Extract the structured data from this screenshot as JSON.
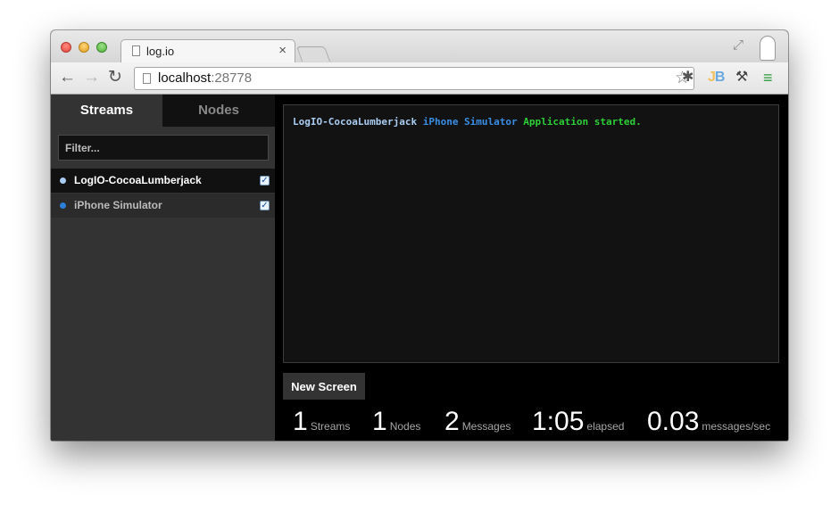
{
  "browser": {
    "tab_title": "log.io",
    "tab_close": "×",
    "url_host": "localhost",
    "url_port": ":28778",
    "nav": {
      "back": "←",
      "forward": "→",
      "reload": "C"
    },
    "icons": [
      "page-icon",
      "star-icon",
      "bug-extension-icon",
      "jb-extension-icon",
      "wrench-icon",
      "menu-icon",
      "fullscreen-icon",
      "profile-icon"
    ]
  },
  "sidebar": {
    "tabs": [
      {
        "label": "Streams",
        "active": true
      },
      {
        "label": "Nodes",
        "active": false
      }
    ],
    "filter_placeholder": "Filter...",
    "streams": [
      {
        "label": "LogIO-CocoaLumberjack",
        "color": "#a9cdf2",
        "checked": true,
        "selected": true
      },
      {
        "label": "iPhone Simulator",
        "color": "#2b7fd6",
        "checked": true,
        "selected": false
      }
    ]
  },
  "log": {
    "stream": "LogIO-CocoaLumberjack",
    "node": "iPhone Simulator",
    "message": "Application started.",
    "colors": {
      "stream": "#a9cdf2",
      "node": "#3a8ee6",
      "message": "#2ccf36"
    }
  },
  "main": {
    "new_screen_label": "New Screen"
  },
  "stats": [
    {
      "value": "1",
      "label": "Streams"
    },
    {
      "value": "1",
      "label": "Nodes"
    },
    {
      "value": "2",
      "label": "Messages"
    },
    {
      "value": "1:05",
      "label": "elapsed"
    },
    {
      "value": "0.03",
      "label": "messages/sec"
    }
  ]
}
